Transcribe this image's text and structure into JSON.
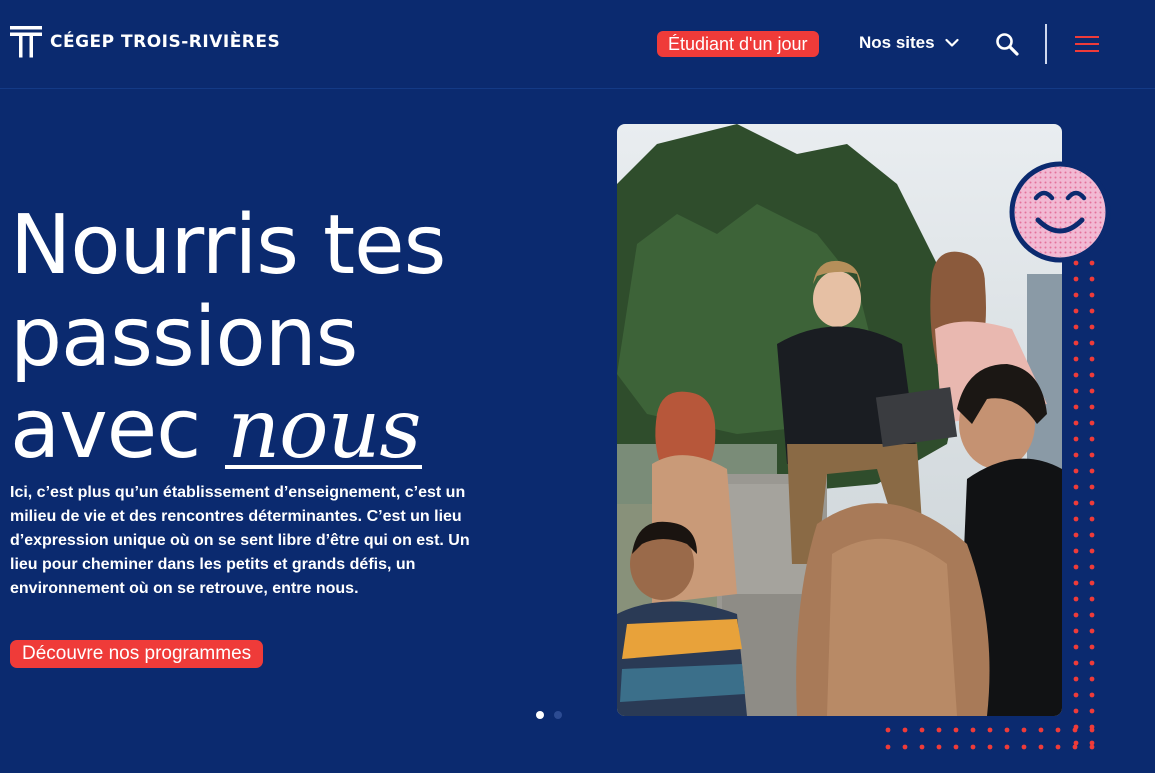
{
  "header": {
    "logo_text": "CÉGEP TROIS-RIVIÈRES",
    "cta_day": "Étudiant d'un jour",
    "nos_sites": "Nos sites",
    "icons": {
      "logo": "logo-t-icon",
      "dropdown": "chevron-down-icon",
      "search": "search-icon",
      "menu": "hamburger-menu-icon"
    }
  },
  "hero": {
    "title_line1": "Nourris tes",
    "title_line2": "passions",
    "title_line3_plain": "avec ",
    "title_line3_emph": "nous",
    "description": "Ici, c’est plus qu’un établissement d’enseignement, c’est un milieu de vie et des rencontres déterminantes. C’est un lieu d’expression unique où on se sent libre d’être qui on est. Un lieu pour cheminer dans les petits et grands défis, un environnement où on se retrouve, entre nous.",
    "button": "Découvre nos programmes"
  },
  "carousel": {
    "total": 2,
    "active": 1
  },
  "colors": {
    "background": "#0b2a6f",
    "accent": "#ef3b39",
    "smiley": "#f2b9d3",
    "text": "#ffffff"
  }
}
